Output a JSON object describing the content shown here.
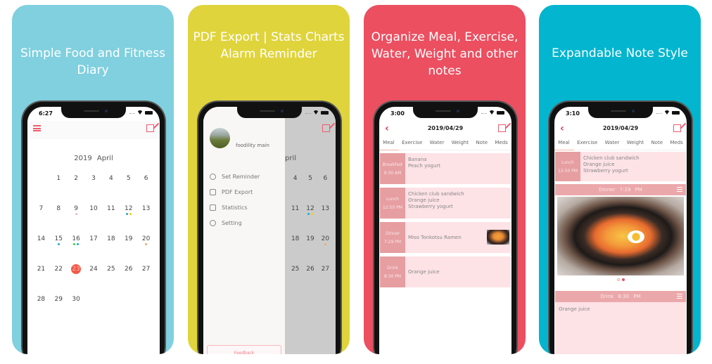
{
  "colors": {
    "card1_bg": "#80d0df",
    "card2_bg": "#e0d43c",
    "card3_bg": "#eb4f60",
    "card4_bg": "#03b5cf",
    "accent": "#ef5a6e",
    "entry_label_bg": "#e69ea1",
    "entry_body_bg": "#fde2e6",
    "selected_day": "#f05a4a"
  },
  "cards": [
    {
      "caption": "Simple Food and Fitness Diary",
      "screen": {
        "status_time": "6:27",
        "calendar_title": "2019 April",
        "days": [
          {
            "n": "",
            "dots": []
          },
          {
            "n": "1",
            "dots": []
          },
          {
            "n": "2",
            "dots": []
          },
          {
            "n": "3",
            "dots": []
          },
          {
            "n": "4",
            "dots": []
          },
          {
            "n": "5",
            "dots": []
          },
          {
            "n": "6",
            "dots": []
          },
          {
            "n": "7",
            "dots": []
          },
          {
            "n": "8",
            "dots": []
          },
          {
            "n": "9",
            "dots": [
              "#f7b6c8"
            ]
          },
          {
            "n": "10",
            "dots": []
          },
          {
            "n": "11",
            "dots": []
          },
          {
            "n": "12",
            "dots": [
              "#1aa6d6",
              "#f2cc1b"
            ]
          },
          {
            "n": "13",
            "dots": []
          },
          {
            "n": "14",
            "dots": []
          },
          {
            "n": "15",
            "dots": [
              "#1aa6d6"
            ]
          },
          {
            "n": "16",
            "dots": [
              "#37d34b",
              "#1aa6d6"
            ]
          },
          {
            "n": "17",
            "dots": []
          },
          {
            "n": "18",
            "dots": []
          },
          {
            "n": "19",
            "dots": []
          },
          {
            "n": "20",
            "dots": [
              "#f5a86c"
            ]
          },
          {
            "n": "21",
            "dots": []
          },
          {
            "n": "22",
            "dots": []
          },
          {
            "n": "23",
            "dots": [],
            "selected": true
          },
          {
            "n": "24",
            "dots": []
          },
          {
            "n": "25",
            "dots": []
          },
          {
            "n": "26",
            "dots": []
          },
          {
            "n": "27",
            "dots": []
          },
          {
            "n": "28",
            "dots": []
          },
          {
            "n": "29",
            "dots": []
          },
          {
            "n": "30",
            "dots": []
          }
        ]
      }
    },
    {
      "caption": "PDF Export | Stats Charts Alarm Reminder",
      "screen": {
        "user_name": "foodility main",
        "partial_month": "pril",
        "menu": [
          {
            "label": "Set Reminder",
            "icon": "alarm-clock-icon"
          },
          {
            "label": "PDF Export",
            "icon": "pdf-file-icon"
          },
          {
            "label": "Statistics",
            "icon": "chart-monitor-icon"
          },
          {
            "label": "Setting",
            "icon": "gear-icon"
          }
        ],
        "feedback_label": "Feedback",
        "visible_days": [
          [
            "4",
            "5",
            "6"
          ],
          [
            "11",
            "12",
            "13"
          ],
          [
            "18",
            "19",
            "20"
          ],
          [
            "25",
            "26",
            "27"
          ]
        ]
      }
    },
    {
      "caption": "Organize Meal, Exercise, Water, Weight and other notes",
      "screen": {
        "status_time": "3:00",
        "date": "2019/04/29",
        "tabs": [
          "Meal",
          "Exercise",
          "Water",
          "Weight",
          "Note",
          "Meds"
        ],
        "active_tab": "Meal",
        "entries": [
          {
            "label": "Breakfast",
            "time": "9:30 AM",
            "items": [
              "Banana",
              "Peach yogurt"
            ],
            "has_photo": false
          },
          {
            "label": "Lunch",
            "time": "12:50 PM",
            "items": [
              "Chicken club sandwich",
              "Orange juice",
              "Strawberry yogurt"
            ],
            "has_photo": false
          },
          {
            "label": "Dinner",
            "time": "7:29 PM",
            "items": [
              "Miso Tonkotsu Ramen"
            ],
            "has_photo": true
          },
          {
            "label": "Drink",
            "time": "8:30 PM",
            "items": [
              "Orange juice"
            ],
            "has_photo": false
          }
        ]
      }
    },
    {
      "caption": "Expandable Note Style",
      "screen": {
        "status_time": "3:10",
        "date": "2019/04/29",
        "tabs": [
          "Meal",
          "Exercise",
          "Water",
          "Weight",
          "Note",
          "Meds"
        ],
        "active_tab": "Meal",
        "lunch": {
          "label": "Lunch",
          "time": "12:50 PM",
          "items": [
            "Chicken club sandwich",
            "Orange juice",
            "Strawberry yogurt"
          ]
        },
        "dinner_header": {
          "label": "Dinner",
          "time": "7:29 PM"
        },
        "photo_pages": {
          "total": 2,
          "current": 2
        },
        "drink_header": {
          "label": "Drink",
          "time": "8:30 PM"
        },
        "drink_note": "Orange juice"
      }
    }
  ]
}
